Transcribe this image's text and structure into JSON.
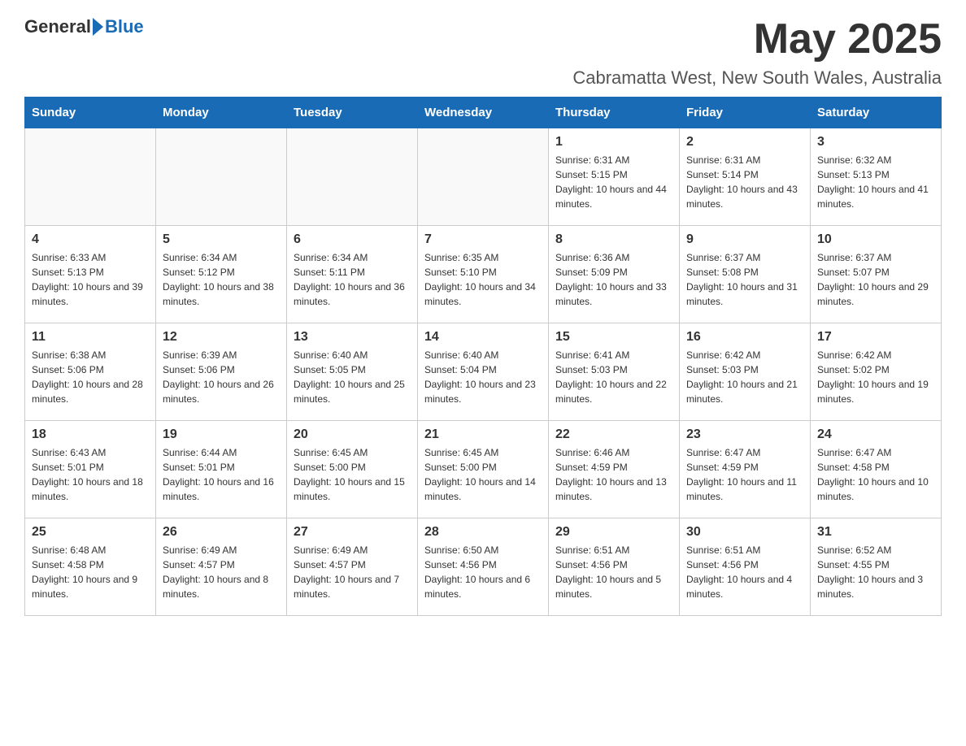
{
  "header": {
    "logo_general": "General",
    "logo_blue": "Blue",
    "month_title": "May 2025",
    "location": "Cabramatta West, New South Wales, Australia"
  },
  "days_of_week": [
    "Sunday",
    "Monday",
    "Tuesday",
    "Wednesday",
    "Thursday",
    "Friday",
    "Saturday"
  ],
  "weeks": [
    [
      {
        "day": "",
        "sunrise": "",
        "sunset": "",
        "daylight": ""
      },
      {
        "day": "",
        "sunrise": "",
        "sunset": "",
        "daylight": ""
      },
      {
        "day": "",
        "sunrise": "",
        "sunset": "",
        "daylight": ""
      },
      {
        "day": "",
        "sunrise": "",
        "sunset": "",
        "daylight": ""
      },
      {
        "day": "1",
        "sunrise": "Sunrise: 6:31 AM",
        "sunset": "Sunset: 5:15 PM",
        "daylight": "Daylight: 10 hours and 44 minutes."
      },
      {
        "day": "2",
        "sunrise": "Sunrise: 6:31 AM",
        "sunset": "Sunset: 5:14 PM",
        "daylight": "Daylight: 10 hours and 43 minutes."
      },
      {
        "day": "3",
        "sunrise": "Sunrise: 6:32 AM",
        "sunset": "Sunset: 5:13 PM",
        "daylight": "Daylight: 10 hours and 41 minutes."
      }
    ],
    [
      {
        "day": "4",
        "sunrise": "Sunrise: 6:33 AM",
        "sunset": "Sunset: 5:13 PM",
        "daylight": "Daylight: 10 hours and 39 minutes."
      },
      {
        "day": "5",
        "sunrise": "Sunrise: 6:34 AM",
        "sunset": "Sunset: 5:12 PM",
        "daylight": "Daylight: 10 hours and 38 minutes."
      },
      {
        "day": "6",
        "sunrise": "Sunrise: 6:34 AM",
        "sunset": "Sunset: 5:11 PM",
        "daylight": "Daylight: 10 hours and 36 minutes."
      },
      {
        "day": "7",
        "sunrise": "Sunrise: 6:35 AM",
        "sunset": "Sunset: 5:10 PM",
        "daylight": "Daylight: 10 hours and 34 minutes."
      },
      {
        "day": "8",
        "sunrise": "Sunrise: 6:36 AM",
        "sunset": "Sunset: 5:09 PM",
        "daylight": "Daylight: 10 hours and 33 minutes."
      },
      {
        "day": "9",
        "sunrise": "Sunrise: 6:37 AM",
        "sunset": "Sunset: 5:08 PM",
        "daylight": "Daylight: 10 hours and 31 minutes."
      },
      {
        "day": "10",
        "sunrise": "Sunrise: 6:37 AM",
        "sunset": "Sunset: 5:07 PM",
        "daylight": "Daylight: 10 hours and 29 minutes."
      }
    ],
    [
      {
        "day": "11",
        "sunrise": "Sunrise: 6:38 AM",
        "sunset": "Sunset: 5:06 PM",
        "daylight": "Daylight: 10 hours and 28 minutes."
      },
      {
        "day": "12",
        "sunrise": "Sunrise: 6:39 AM",
        "sunset": "Sunset: 5:06 PM",
        "daylight": "Daylight: 10 hours and 26 minutes."
      },
      {
        "day": "13",
        "sunrise": "Sunrise: 6:40 AM",
        "sunset": "Sunset: 5:05 PM",
        "daylight": "Daylight: 10 hours and 25 minutes."
      },
      {
        "day": "14",
        "sunrise": "Sunrise: 6:40 AM",
        "sunset": "Sunset: 5:04 PM",
        "daylight": "Daylight: 10 hours and 23 minutes."
      },
      {
        "day": "15",
        "sunrise": "Sunrise: 6:41 AM",
        "sunset": "Sunset: 5:03 PM",
        "daylight": "Daylight: 10 hours and 22 minutes."
      },
      {
        "day": "16",
        "sunrise": "Sunrise: 6:42 AM",
        "sunset": "Sunset: 5:03 PM",
        "daylight": "Daylight: 10 hours and 21 minutes."
      },
      {
        "day": "17",
        "sunrise": "Sunrise: 6:42 AM",
        "sunset": "Sunset: 5:02 PM",
        "daylight": "Daylight: 10 hours and 19 minutes."
      }
    ],
    [
      {
        "day": "18",
        "sunrise": "Sunrise: 6:43 AM",
        "sunset": "Sunset: 5:01 PM",
        "daylight": "Daylight: 10 hours and 18 minutes."
      },
      {
        "day": "19",
        "sunrise": "Sunrise: 6:44 AM",
        "sunset": "Sunset: 5:01 PM",
        "daylight": "Daylight: 10 hours and 16 minutes."
      },
      {
        "day": "20",
        "sunrise": "Sunrise: 6:45 AM",
        "sunset": "Sunset: 5:00 PM",
        "daylight": "Daylight: 10 hours and 15 minutes."
      },
      {
        "day": "21",
        "sunrise": "Sunrise: 6:45 AM",
        "sunset": "Sunset: 5:00 PM",
        "daylight": "Daylight: 10 hours and 14 minutes."
      },
      {
        "day": "22",
        "sunrise": "Sunrise: 6:46 AM",
        "sunset": "Sunset: 4:59 PM",
        "daylight": "Daylight: 10 hours and 13 minutes."
      },
      {
        "day": "23",
        "sunrise": "Sunrise: 6:47 AM",
        "sunset": "Sunset: 4:59 PM",
        "daylight": "Daylight: 10 hours and 11 minutes."
      },
      {
        "day": "24",
        "sunrise": "Sunrise: 6:47 AM",
        "sunset": "Sunset: 4:58 PM",
        "daylight": "Daylight: 10 hours and 10 minutes."
      }
    ],
    [
      {
        "day": "25",
        "sunrise": "Sunrise: 6:48 AM",
        "sunset": "Sunset: 4:58 PM",
        "daylight": "Daylight: 10 hours and 9 minutes."
      },
      {
        "day": "26",
        "sunrise": "Sunrise: 6:49 AM",
        "sunset": "Sunset: 4:57 PM",
        "daylight": "Daylight: 10 hours and 8 minutes."
      },
      {
        "day": "27",
        "sunrise": "Sunrise: 6:49 AM",
        "sunset": "Sunset: 4:57 PM",
        "daylight": "Daylight: 10 hours and 7 minutes."
      },
      {
        "day": "28",
        "sunrise": "Sunrise: 6:50 AM",
        "sunset": "Sunset: 4:56 PM",
        "daylight": "Daylight: 10 hours and 6 minutes."
      },
      {
        "day": "29",
        "sunrise": "Sunrise: 6:51 AM",
        "sunset": "Sunset: 4:56 PM",
        "daylight": "Daylight: 10 hours and 5 minutes."
      },
      {
        "day": "30",
        "sunrise": "Sunrise: 6:51 AM",
        "sunset": "Sunset: 4:56 PM",
        "daylight": "Daylight: 10 hours and 4 minutes."
      },
      {
        "day": "31",
        "sunrise": "Sunrise: 6:52 AM",
        "sunset": "Sunset: 4:55 PM",
        "daylight": "Daylight: 10 hours and 3 minutes."
      }
    ]
  ]
}
